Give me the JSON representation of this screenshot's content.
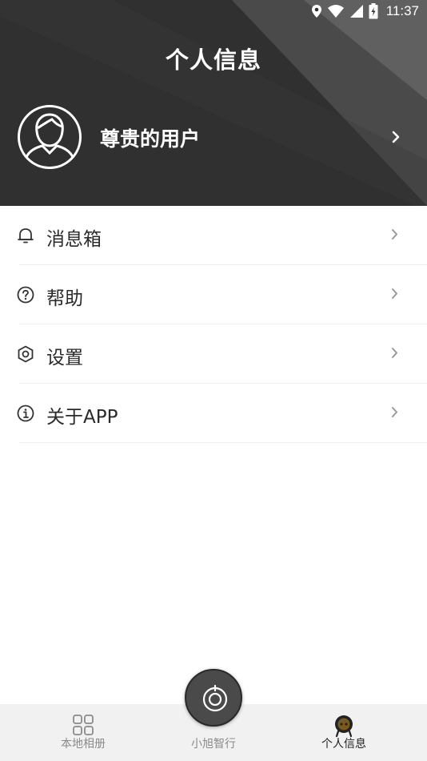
{
  "status_bar": {
    "time": "11:37",
    "icons": [
      "location-icon",
      "wifi-icon",
      "signal-icon",
      "battery-icon"
    ]
  },
  "header": {
    "title": "个人信息",
    "username": "尊贵的用户",
    "icons": [
      "avatar-icon",
      "chevron-right-icon"
    ]
  },
  "menu": {
    "items": [
      {
        "label": "消息箱",
        "icon": "bell-icon"
      },
      {
        "label": "帮助",
        "icon": "help-circle-icon"
      },
      {
        "label": "设置",
        "icon": "settings-hexagon-icon"
      },
      {
        "label": "关于APP",
        "icon": "info-circle-icon"
      }
    ]
  },
  "tabbar": {
    "tabs": [
      {
        "label": "本地相册",
        "icon": "grid-icon",
        "active": false
      },
      {
        "label": "小旭智行",
        "icon": "camera-icon",
        "active": false
      },
      {
        "label": "个人信息",
        "icon": "robot-face-icon",
        "active": true
      }
    ]
  },
  "colors": {
    "header_bg": "#2e2e2e",
    "text_primary": "#2a2a2a",
    "tab_inactive": "#8a8a8a",
    "tab_active": "#222222",
    "tabbar_bg": "#f1f1f1"
  }
}
